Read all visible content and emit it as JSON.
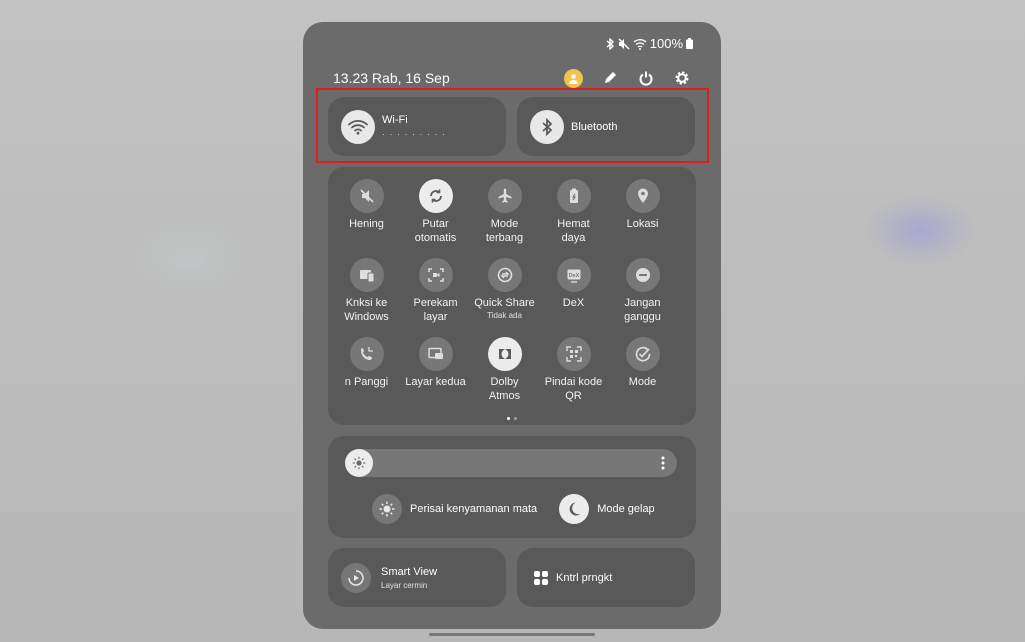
{
  "status_bar": {
    "battery": "100%"
  },
  "header": {
    "datetime": "13.23  Rab, 16 Sep"
  },
  "tiles": {
    "wifi": {
      "label": "Wi-Fi",
      "sub": "· · · · · · · · ·"
    },
    "bluetooth": {
      "label": "Bluetooth"
    }
  },
  "quick_toggles": [
    {
      "label": "Hening",
      "sub": "",
      "active": false
    },
    {
      "label": "Putar\notomatis",
      "sub": "",
      "active": true
    },
    {
      "label": "Mode\nterbang",
      "sub": "",
      "active": false
    },
    {
      "label": "Hemat\ndaya",
      "sub": "",
      "active": false
    },
    {
      "label": "Lokasi",
      "sub": "",
      "active": false
    },
    {
      "label": "Knksi ke\nWindows",
      "sub": "",
      "active": false
    },
    {
      "label": "Perekam\nlayar",
      "sub": "",
      "active": false
    },
    {
      "label": "Quick Share",
      "sub": "Tidak ada",
      "active": false
    },
    {
      "label": "DeX",
      "sub": "",
      "active": false
    },
    {
      "label": "Jangan\nganggu",
      "sub": "",
      "active": false
    },
    {
      "label": "n      Panggi",
      "sub": "",
      "active": false
    },
    {
      "label": "Layar kedua",
      "sub": "",
      "active": false
    },
    {
      "label": "Dolby\nAtmos",
      "sub": "",
      "active": true
    },
    {
      "label": "Pindai kode\nQR",
      "sub": "",
      "active": false
    },
    {
      "label": "Mode",
      "sub": "",
      "active": false
    }
  ],
  "brightness": {
    "level_percent": 6
  },
  "display_toggles": {
    "eye_comfort": "Perisai kenyamanan mata",
    "dark_mode": "Mode gelap"
  },
  "bottom_tiles": {
    "smart_view": {
      "label": "Smart View",
      "sub": "Layar cermin"
    },
    "device_control": {
      "label": "Kntrl prngkt"
    }
  }
}
